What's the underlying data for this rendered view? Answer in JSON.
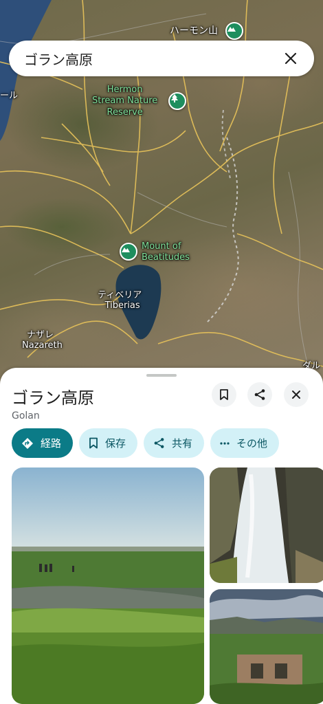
{
  "search": {
    "query": "ゴラン高原",
    "close_label": "Close"
  },
  "map": {
    "places": {
      "hermon_jp": "ハーモン山",
      "left_edge": "ール",
      "tiberias_jp": "ティベリア",
      "tiberias_en": "Tiberias",
      "nazareth_jp": "ナザレ",
      "nazareth_en": "Nazareth",
      "right_edge": "ダル"
    },
    "pois": {
      "hermon_reserve": [
        "Hermon",
        "Stream Nature",
        "Reserve"
      ],
      "beatitudes": [
        "Mount of",
        "Beatitudes"
      ]
    }
  },
  "place": {
    "name": "ゴラン高原",
    "subtitle": "Golan",
    "actions": {
      "directions": "経路",
      "save": "保存",
      "share": "共有",
      "more": "その他"
    }
  },
  "colors": {
    "accent": "#0b7b87",
    "chip_bg": "#d3f1f7",
    "poi_green": "#1e8e5e",
    "lake": "#1d3a52"
  }
}
